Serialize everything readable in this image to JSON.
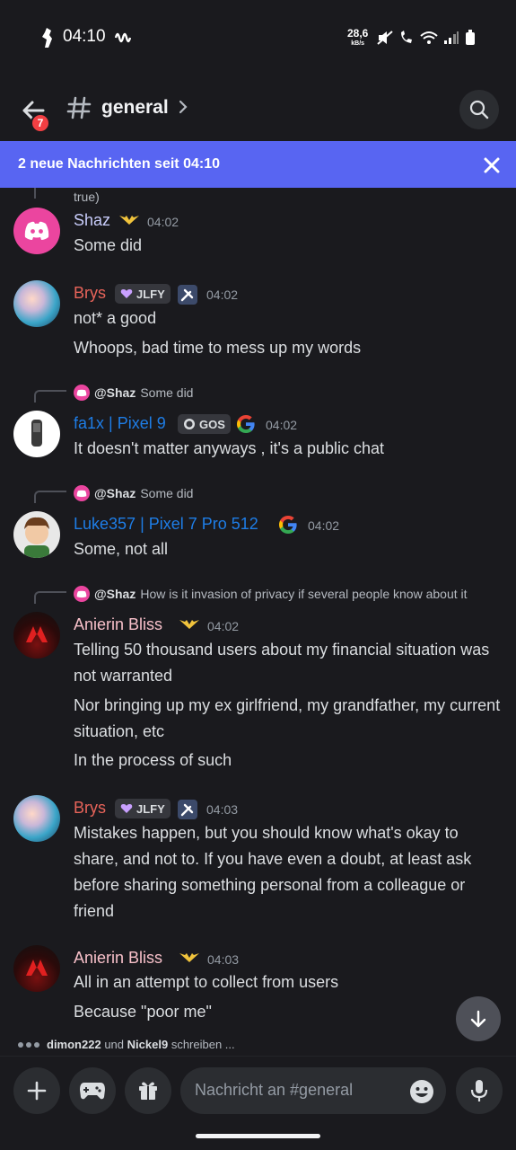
{
  "status_bar": {
    "time": "04:10",
    "rate_value": "28,6",
    "rate_unit": "kB/s"
  },
  "header": {
    "back_badge": "7",
    "channel_name": "general"
  },
  "banner": {
    "text": "2 neue Nachrichten seit 04:10"
  },
  "messages": {
    "prev_tail": "true)",
    "m1": {
      "author": "Shaz",
      "time": "04:02",
      "lines": [
        "Some did"
      ]
    },
    "m2": {
      "author": "Brys",
      "tag": "JLFY",
      "time": "04:02",
      "lines": [
        "not* a good",
        "Whoops, bad time to mess up my words"
      ]
    },
    "m3": {
      "reply_author": "@Shaz",
      "reply_text": "Some did",
      "author": "fa1x | Pixel 9",
      "tag": "GOS",
      "time": "04:02",
      "lines": [
        "It doesn't matter anyways , it's a public chat"
      ]
    },
    "m4": {
      "reply_author": "@Shaz",
      "reply_text": "Some did",
      "author": "Luke357 | Pixel 7 Pro 512",
      "time": "04:02",
      "lines": [
        "Some, not all"
      ]
    },
    "m5": {
      "reply_author": "@Shaz",
      "reply_text": "How is it invasion of privacy if several people know about it",
      "author": "Anierin Bliss",
      "time": "04:02",
      "lines": [
        "Telling 50 thousand users about my financial situation was not warranted",
        "Nor bringing up  my ex girlfriend, my grandfather, my current situation, etc",
        "In the process of such"
      ]
    },
    "m6": {
      "author": "Brys",
      "tag": "JLFY",
      "time": "04:03",
      "lines": [
        "Mistakes happen, but you should know what's okay to share, and not to. If you have even a doubt, at least ask before sharing something personal from a colleague or friend"
      ]
    },
    "m7": {
      "author": "Anierin Bliss",
      "time": "04:03",
      "lines": [
        "All in an attempt to collect from users",
        "Because \"poor me\""
      ]
    }
  },
  "typing": {
    "user1": "dimon222",
    "joiner": "und",
    "user2": "Nickel9",
    "suffix": "schreiben ..."
  },
  "composer": {
    "placeholder": "Nachricht an #general"
  },
  "colors": {
    "banner": "#5865f2",
    "shaz_name": "#c9cdfb",
    "brys_name": "#e8645a",
    "pixel_name": "#1e7de6",
    "anierin_name": "#f7c0c9"
  }
}
